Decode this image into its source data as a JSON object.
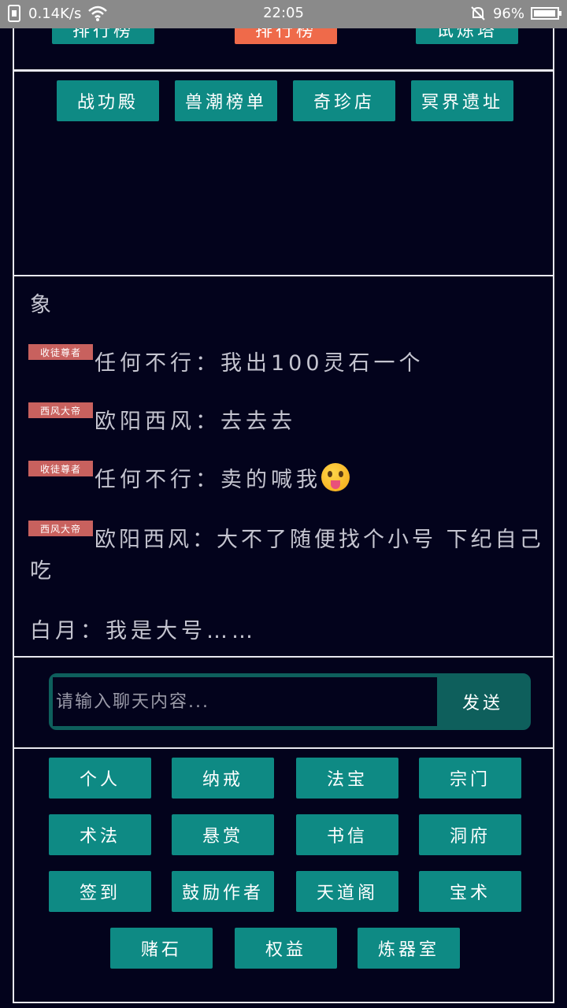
{
  "status_bar": {
    "network_speed": "0.14K/s",
    "time": "22:05",
    "battery": "96%",
    "battery_level": 0.96
  },
  "top_buttons_partial": [
    {
      "label": "排行榜"
    },
    {
      "label": "排行榜"
    },
    {
      "label": "试炼塔"
    }
  ],
  "nav_row": [
    {
      "label": "战功殿"
    },
    {
      "label": "兽潮榜单"
    },
    {
      "label": "奇珍店"
    },
    {
      "label": "冥界遗址"
    }
  ],
  "chat": {
    "partial_line": "象",
    "messages": [
      {
        "badge": "收徒尊者",
        "text": "任何不行：我出100灵石一个"
      },
      {
        "badge": "西风大帝",
        "text": "欧阳西风：去去去"
      },
      {
        "badge": "收徒尊者",
        "text": "任何不行：卖的喊我"
      },
      {
        "badge": "西风大帝",
        "text": "欧阳西风：大不了随便找个小号 下纪自己",
        "continuation": "吃"
      },
      {
        "text": "白月：我是大号……"
      }
    ]
  },
  "input": {
    "placeholder": "请输入聊天内容...",
    "send_label": "发送"
  },
  "menu": {
    "row1": [
      "个人",
      "纳戒",
      "法宝",
      "宗门"
    ],
    "row2": [
      "术法",
      "悬赏",
      "书信",
      "洞府"
    ],
    "row3": [
      "签到",
      "鼓励作者",
      "天道阁",
      "宝术"
    ],
    "row4": [
      "赌石",
      "权益",
      "炼器室"
    ]
  }
}
